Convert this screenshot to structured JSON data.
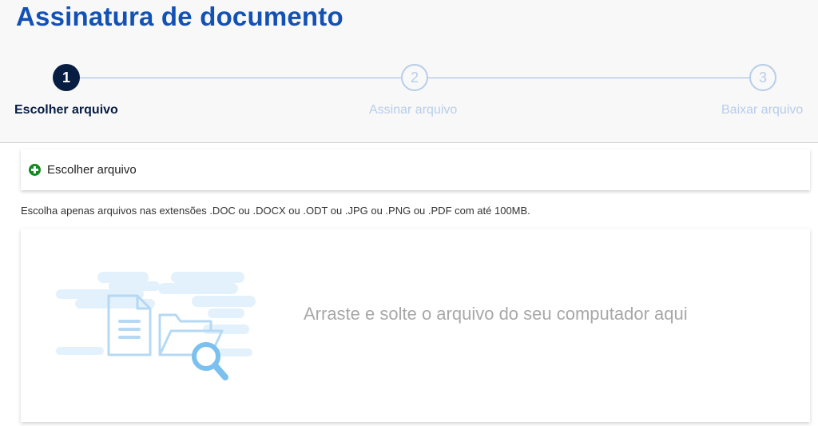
{
  "page": {
    "title": "Assinatura de documento"
  },
  "steps": [
    {
      "number": "1",
      "label": "Escolher arquivo",
      "state": "active"
    },
    {
      "number": "2",
      "label": "Assinar arquivo",
      "state": "inactive"
    },
    {
      "number": "3",
      "label": "Baixar arquivo",
      "state": "inactive"
    }
  ],
  "upload": {
    "choose_label": "Escolher arquivo",
    "choose_icon": "plus-circle-icon",
    "hint": "Escolha apenas arquivos nas extensões .DOC ou .DOCX ou .ODT ou .JPG ou .PNG ou .PDF com até 100MB.",
    "dropzone_text": "Arraste e solte o arquivo do seu computador aqui",
    "dropzone_icon": "file-folder-search-illustration"
  },
  "colors": {
    "title": "#1351b4",
    "active_step": "#071d41",
    "inactive_step": "#b8cde9",
    "plus_icon": "#168821",
    "illustration": "#a9d3f1"
  }
}
